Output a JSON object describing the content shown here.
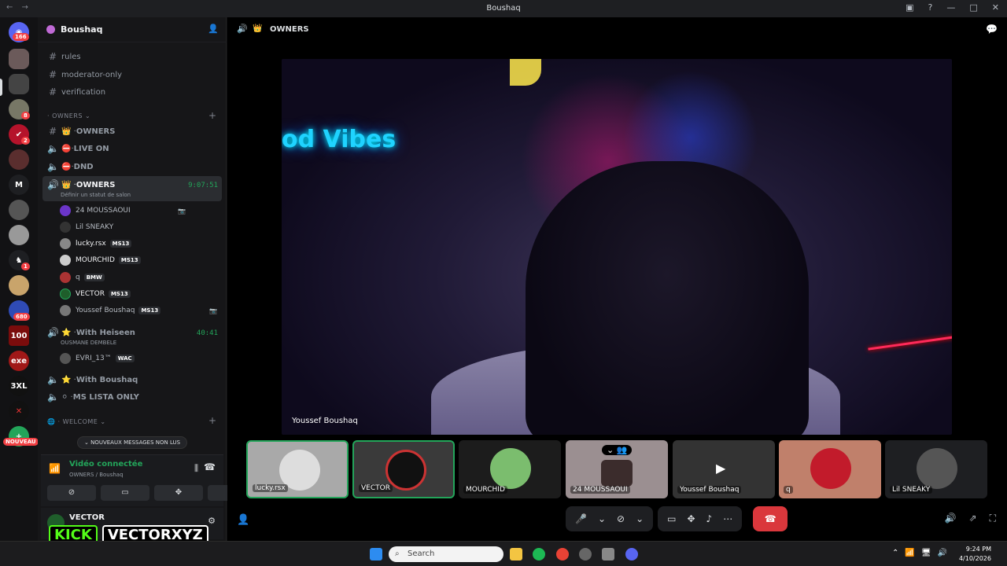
{
  "window": {
    "title": "Boushaq"
  },
  "servers": {
    "badges": [
      "166",
      "8",
      "2",
      "1",
      "680",
      "NOUVEAU"
    ],
    "m_label": "M",
    "x3_label": "3XL",
    "exe_label": "exe"
  },
  "sidebar": {
    "server_name": "Boushaq",
    "channels_top": [
      "rules",
      "moderator-only",
      "verification"
    ],
    "cat_owners": "OWNERS",
    "owners_channels": [
      "OWNERS",
      "LIVE ON",
      "DND"
    ],
    "active_channel": {
      "name": "OWNERS",
      "timer": "9:07:51",
      "status": "Définir un statut de salon"
    },
    "members": [
      {
        "name": "24 MOUSSAOUI",
        "tag": ""
      },
      {
        "name": "Lil SNEAKY",
        "tag": ""
      },
      {
        "name": "lucky.rsx",
        "tag": "MS13"
      },
      {
        "name": "MOURCHID",
        "tag": "MS13"
      },
      {
        "name": "q",
        "tag": "BMW"
      },
      {
        "name": "VECTOR",
        "tag": "MS13"
      },
      {
        "name": "Youssef Boushaq",
        "tag": "MS13"
      }
    ],
    "heisen": {
      "name": "With Heiseen",
      "timer": "40:41",
      "sub": "OUSMANE DEMBELE",
      "member": "EVRI_13™",
      "tag": "WAC"
    },
    "more_channels": [
      "With Boushaq",
      "MS LISTA ONLY"
    ],
    "cat_welcome": "WELCOME",
    "new_messages": "NOUVEAUX MESSAGES NON LUS",
    "voice": {
      "status": "Vidéo connectée",
      "location": "OWNERS / Boushaq"
    },
    "user": {
      "name": "VECTOR"
    }
  },
  "main": {
    "channel": "OWNERS",
    "stage_caption": "Youssef Boushaq",
    "neon": "od Vibes"
  },
  "tiles": [
    "lucky.rsx",
    "VECTOR",
    "MOURCHID",
    "24 MOUSSAOUI",
    "Youssef Boushaq",
    "q",
    "Lil SNEAKY"
  ],
  "overlay": {
    "kick": "KICK",
    "handle": "VECTORXYZ"
  },
  "taskbar": {
    "search": "Search",
    "time": "9:24 PM",
    "date": "4/10/2026"
  }
}
